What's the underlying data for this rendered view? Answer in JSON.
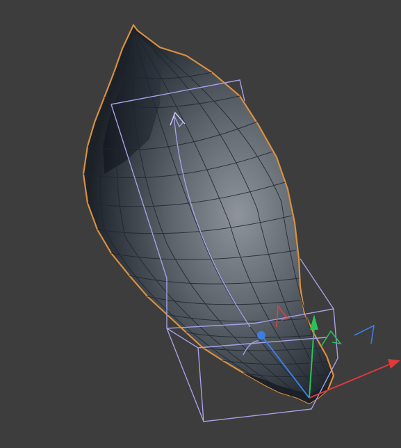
{
  "viewport": {
    "background_color": "#3d3d3d",
    "selection_outline_color": "#d9903f",
    "deformer_cage_color": "#a7a0e6",
    "mesh_wire_color": "#1e2530",
    "mesh_highlight_color": "#8e949a",
    "mesh_shadow_color": "#1c2128"
  },
  "gizmo": {
    "x_axis_color": "#e0393b",
    "y_axis_color": "#27c35a",
    "z_axis_color": "#3b7fe4",
    "icons": [
      "axis-x-arrow-icon",
      "axis-y-arrow-icon",
      "axis-z-arrow-icon"
    ]
  }
}
